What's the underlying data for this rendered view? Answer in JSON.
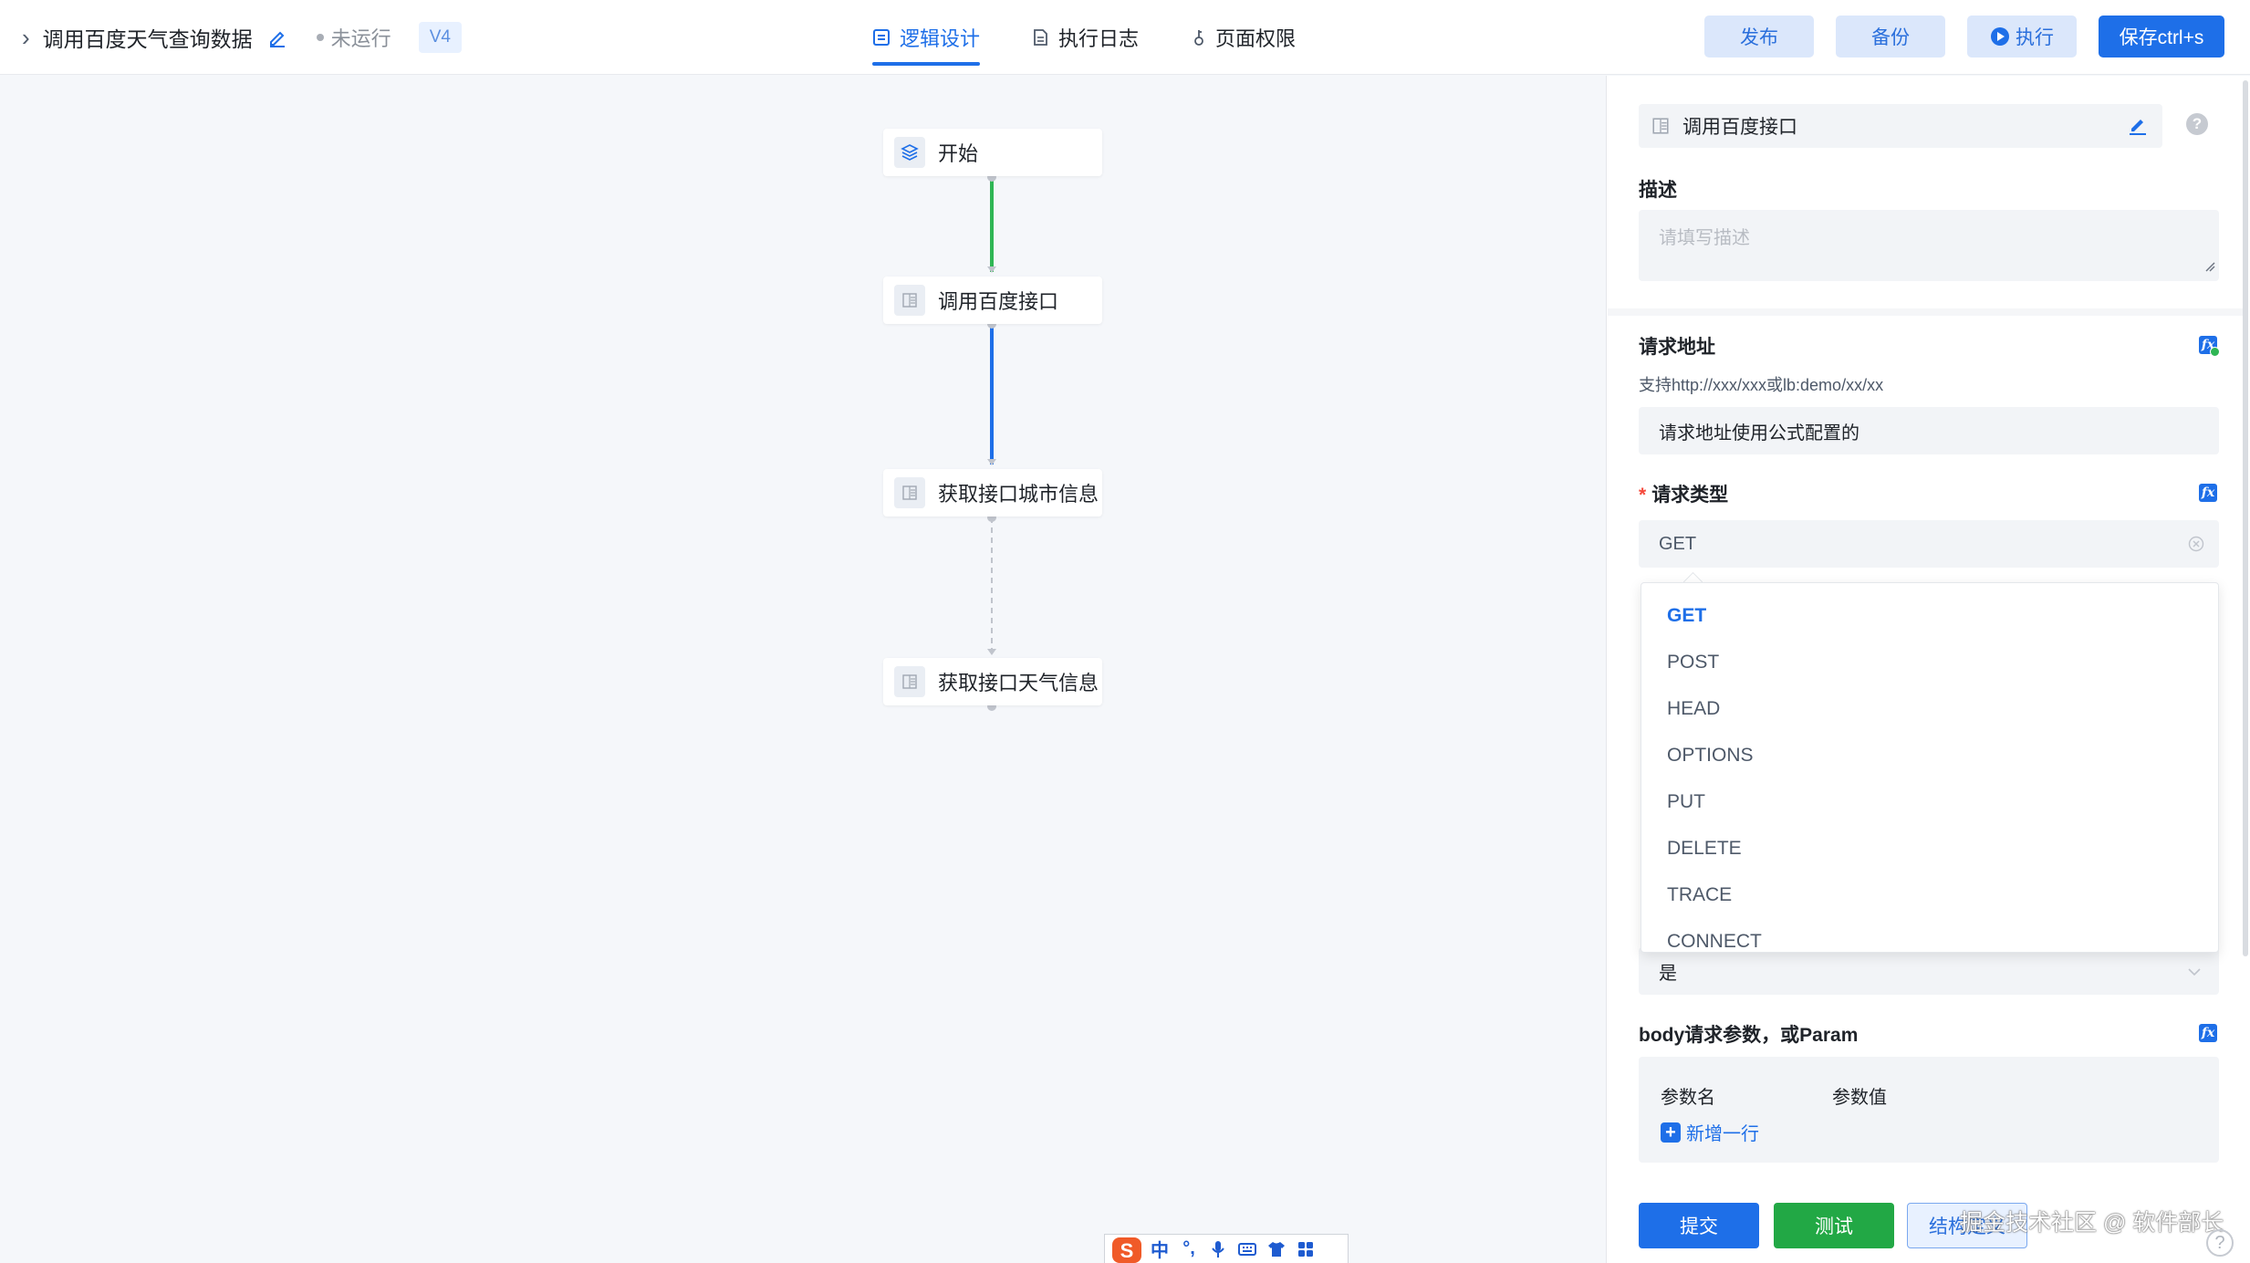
{
  "header": {
    "back_icon": "chevron-right-icon",
    "title": "调用百度天气查询数据",
    "status": "未运行",
    "version": "V4",
    "tabs": [
      {
        "label": "逻辑设计",
        "icon": "logic-design-icon",
        "active": true
      },
      {
        "label": "执行日志",
        "icon": "document-icon",
        "active": false
      },
      {
        "label": "页面权限",
        "icon": "key-icon",
        "active": false
      }
    ],
    "buttons": {
      "publish": "发布",
      "backup": "备份",
      "run": "执行",
      "save": "保存ctrl+s"
    }
  },
  "flow": {
    "nodes": [
      {
        "label": "开始",
        "icon": "layers-icon"
      },
      {
        "label": "调用百度接口",
        "icon": "api-node-icon"
      },
      {
        "label": "获取接口城市信息",
        "icon": "api-node-icon"
      },
      {
        "label": "获取接口天气信息",
        "icon": "api-node-icon"
      }
    ],
    "edge_colors": [
      "#2fb654",
      "#1e6fe8",
      "#c0c4cc"
    ]
  },
  "panel": {
    "node_name": "调用百度接口",
    "description_label": "描述",
    "description_placeholder": "请填写描述",
    "url_label": "请求地址",
    "url_hint": "支持http://xxx/xxx或lb:demo/xx/xx",
    "url_value": "请求地址使用公式配置的",
    "method_label": "请求类型",
    "method_value": "GET",
    "method_options": [
      "GET",
      "POST",
      "HEAD",
      "OPTIONS",
      "PUT",
      "DELETE",
      "TRACE",
      "CONNECT"
    ],
    "hidden_select_value": "是",
    "body_label": "body请求参数，或Param",
    "param_name_header": "参数名",
    "param_value_header": "参数值",
    "add_row_label": "新增一行",
    "submit_label": "提交",
    "test_label": "测试",
    "result_label": "结构定义"
  },
  "overlay": {
    "watermark": "掘金技术社区 @ 软件部长",
    "ime_label": "中"
  },
  "colors": {
    "primary": "#1e6fe8",
    "success": "#22a845",
    "required": "#f5483b"
  }
}
